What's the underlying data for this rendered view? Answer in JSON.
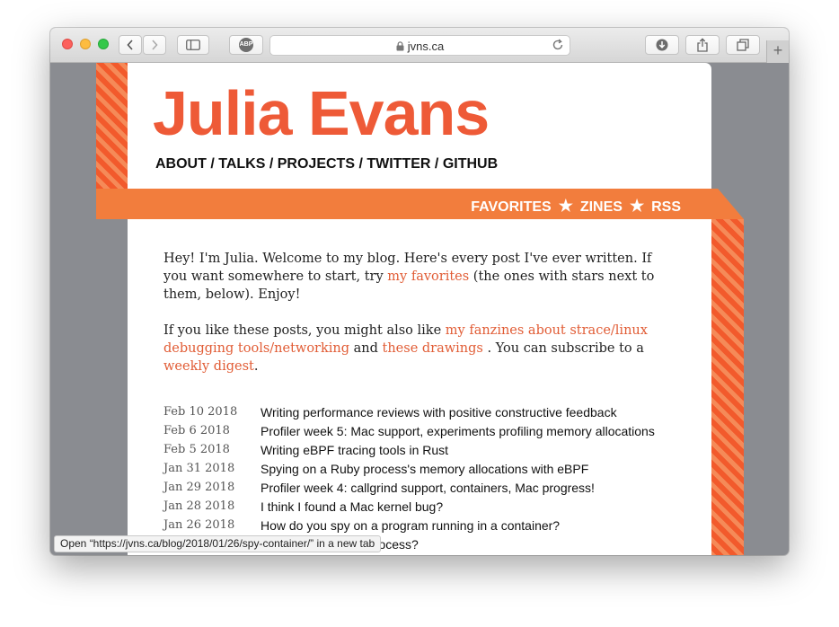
{
  "browser": {
    "url": "jvns.ca",
    "buttons": {
      "back": "back-icon",
      "forward": "forward-icon",
      "sidebar": "sidebar-icon",
      "adblock": "ABP",
      "downloads": "download-icon",
      "share": "share-icon",
      "tabs": "tabs-icon",
      "new_tab": "+"
    }
  },
  "site": {
    "title": "Julia Evans",
    "nav": {
      "about": "ABOUT",
      "talks": "TALKS",
      "projects": "PROJECTS",
      "twitter": "TWITTER",
      "github": "GITHUB",
      "sep": "/"
    },
    "band": {
      "favorites": "FAVORITES",
      "zines": "ZINES",
      "rss": "RSS",
      "star": "★"
    },
    "intro": {
      "t1": "Hey! I'm Julia. Welcome to my blog. Here's every post I've ever written. If you want somewhere to start, try ",
      "link1": "my favorites",
      "t2": " (the ones with stars next to them, below). Enjoy!"
    },
    "more": {
      "t1": "If you like these posts, you might also like ",
      "link1": "my fanzines about strace/linux debugging tools/networking",
      "t2": " and ",
      "link2": "these drawings",
      "t3": " . You can subscribe to a ",
      "link3": "weekly digest",
      "t4": "."
    },
    "posts": [
      {
        "date": "Feb 10 2018",
        "title": "Writing performance reviews with positive constructive feedback"
      },
      {
        "date": "Feb 6 2018",
        "title": "Profiler week 5: Mac support, experiments profiling memory allocations"
      },
      {
        "date": "Feb 5 2018",
        "title": "Writing eBPF tracing tools in Rust"
      },
      {
        "date": "Jan 31 2018",
        "title": "Spying on a Ruby process's memory allocations with eBPF"
      },
      {
        "date": "Jan 29 2018",
        "title": "Profiler week 4: callgrind support, containers, Mac progress!"
      },
      {
        "date": "Jan 28 2018",
        "title": "I think I found a Mac kernel bug?"
      },
      {
        "date": "Jan 26 2018",
        "title": "How do you spy on a program running in a container?"
      },
      {
        "date": "",
        "title": "ory maps of a Mac process?"
      }
    ]
  },
  "status_bar": "Open “https://jvns.ca/blog/2018/01/26/spy-container/” in a new tab",
  "colors": {
    "accent": "#ee5a37",
    "band": "#f27d3d",
    "stripe": "#f25a2c"
  }
}
